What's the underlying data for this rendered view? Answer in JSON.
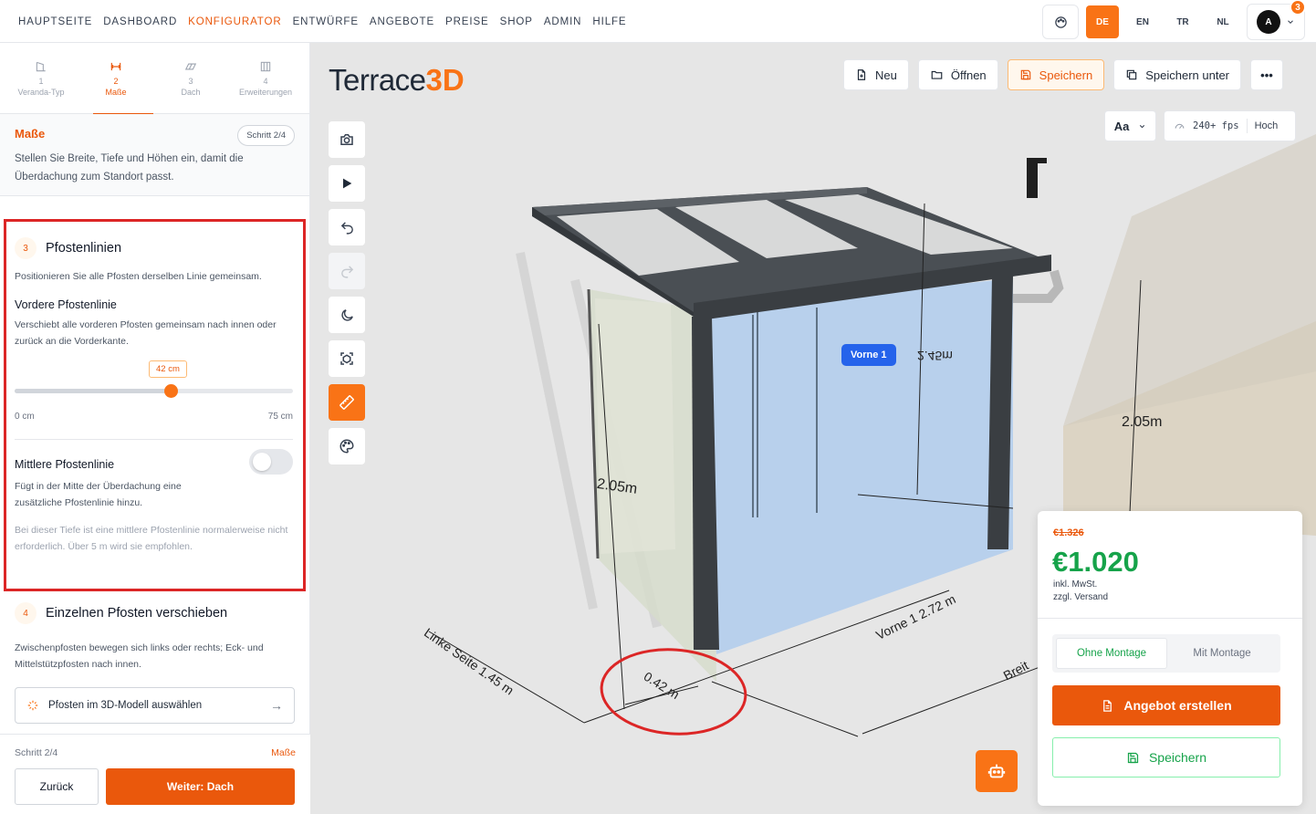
{
  "nav": {
    "links": [
      "HAUPTSEITE",
      "DASHBOARD",
      "KONFIGURATOR",
      "ENTWÜRFE",
      "ANGEBOTE",
      "PREISE",
      "SHOP",
      "ADMIN",
      "HILFE"
    ],
    "active": "KONFIGURATOR",
    "languages": [
      "DE",
      "EN",
      "TR",
      "NL"
    ],
    "active_language": "DE",
    "avatar_initial": "A",
    "notification_count": "3",
    "icons": {
      "theme": "palette-icon",
      "chevron": "chevron-down-icon"
    }
  },
  "steps": [
    {
      "num": "1",
      "label": "Veranda-Typ",
      "icon": "veranda-type-icon"
    },
    {
      "num": "2",
      "label": "Maße",
      "icon": "dimensions-icon"
    },
    {
      "num": "3",
      "label": "Dach",
      "icon": "roof-icon"
    },
    {
      "num": "4",
      "label": "Erweiterungen",
      "icon": "extensions-icon"
    }
  ],
  "intro": {
    "title": "Maße",
    "badge": "Schritt 2/4",
    "text": "Stellen Sie Breite, Tiefe und Höhen ein, damit die Überdachung zum Standort passt."
  },
  "section3": {
    "num": "3",
    "title": "Pfostenlinien",
    "desc": "Positionieren Sie alle Pfosten derselben Linie gemeinsam.",
    "front_title": "Vordere Pfostenlinie",
    "front_desc": "Verschiebt alle vorderen Pfosten gemeinsam nach innen oder zurück an die Vorderkante.",
    "slider_value_label": "42 cm",
    "slider_value": 42,
    "slider_min_value": 0,
    "slider_max_value": 75,
    "slider_min": "0 cm",
    "slider_max": "75 cm",
    "mid_title": "Mittlere Pfostenlinie",
    "mid_desc": "Fügt in der Mitte der Überdachung eine zusätzliche Pfostenlinie hinzu.",
    "mid_enabled": false,
    "hint": "Bei dieser Tiefe ist eine mittlere Pfostenlinie normalerweise nicht erforderlich. Über 5 m wird sie empfohlen."
  },
  "section4": {
    "num": "4",
    "title": "Einzelnen Pfosten verschieben",
    "desc": "Zwischenpfosten bewegen sich links oder rechts; Eck- und Mittelstützpfosten nach innen.",
    "button": "Pfosten im 3D-Modell auswählen"
  },
  "footer": {
    "step": "Schritt 2/4",
    "step_name": "Maße",
    "back": "Zurück",
    "next": "Weiter: Dach"
  },
  "viewport": {
    "logo_main": "Terrace",
    "logo_accent": "3D",
    "toolbar": {
      "new": "Neu",
      "open": "Öffnen",
      "save": "Speichern",
      "save_as": "Speichern unter",
      "more": "•••"
    },
    "font_btn": "Aa",
    "fps": "240+ fps",
    "quality": "Hoch",
    "tools": [
      "camera-icon",
      "play-icon",
      "undo-icon",
      "redo-icon",
      "moon-icon",
      "focus-cube-icon",
      "ruler-icon",
      "palette-icon"
    ],
    "tag": "Vorne 1",
    "dims": {
      "h_back": "2.45m",
      "h_right": "2.05m",
      "h_left": "2.05m",
      "left_side": "Linke Seite 1.45 m",
      "front": "Vorne 1 2.72 m",
      "offset": "0.42 m",
      "width": "Breit"
    }
  },
  "price": {
    "old": "€1.326",
    "new": "€1.020",
    "vat": "inkl. MwSt.",
    "shipping": "zzgl. Versand",
    "opt_without": "Ohne Montage",
    "opt_with": "Mit Montage",
    "cta": "Angebot erstellen",
    "save": "Speichern"
  },
  "colors": {
    "accent": "#ea580c",
    "price_green": "#16a34a",
    "highlight_red": "#dc2626",
    "glass_blue": "#a8c8ee"
  }
}
